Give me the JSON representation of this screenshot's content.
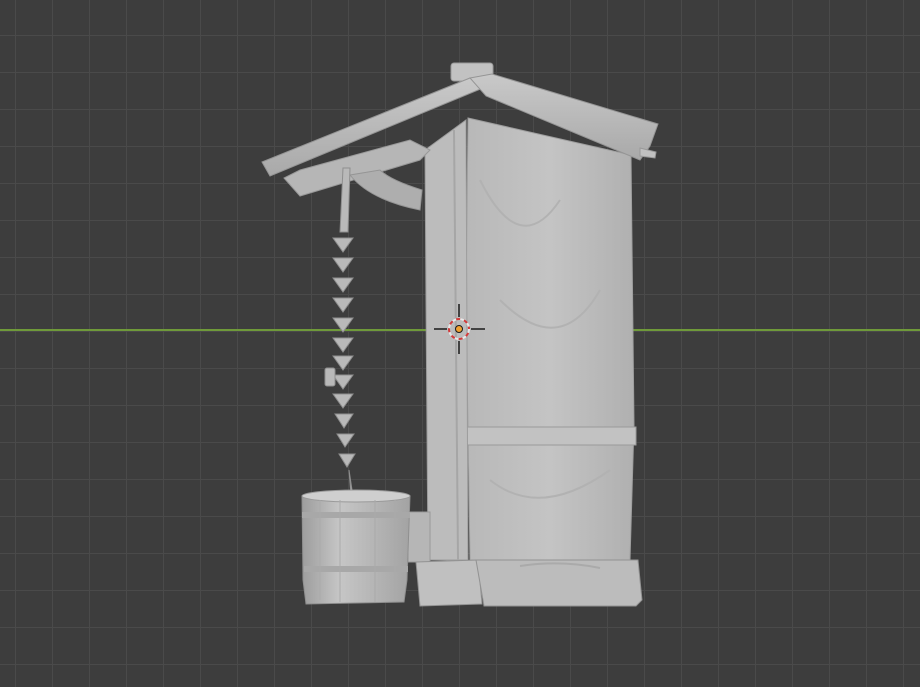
{
  "viewport": {
    "background": "#3d3d3d",
    "grid_color": "#4a4a4a",
    "x_axis_color": "#6f9a3a",
    "model_color": "#bdbdbd",
    "cursor_colors": [
      "#e0e0e0",
      "#d33a3a"
    ]
  },
  "scene": {
    "object": "well-model",
    "parts": [
      "roof",
      "post",
      "wall-panel",
      "chain",
      "bucket",
      "base"
    ]
  },
  "cursor": {
    "icon": "3d-cursor-icon",
    "origin_icon": "object-origin-icon"
  }
}
